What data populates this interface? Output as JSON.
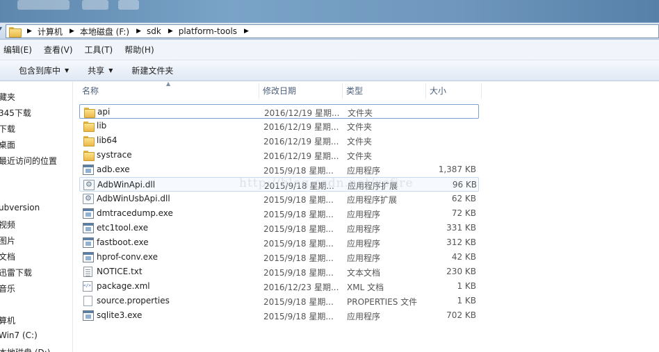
{
  "breadcrumb": [
    "计算机",
    "本地磁盘 (F:)",
    "sdk",
    "platform-tools"
  ],
  "menu": [
    "编辑(E)",
    "查看(V)",
    "工具(T)",
    "帮助(H)"
  ],
  "toolbar": {
    "include_library": "包含到库中",
    "share": "共享",
    "new_folder": "新建文件夹"
  },
  "nav": [
    "藏夹",
    "345下载",
    "下载",
    "桌面",
    "最近访问的位置",
    "ubversion",
    "视频",
    "图片",
    "文档",
    "迅雷下载",
    "音乐",
    "算机",
    "Win7 (C:)",
    "本地磁盘 (D:)"
  ],
  "columns": {
    "name": "名称",
    "date": "修改日期",
    "type": "类型",
    "size": "大小"
  },
  "files": [
    {
      "name": "api",
      "date": "2016/12/19 星期...",
      "type": "文件夹",
      "size": "",
      "icon": "folder"
    },
    {
      "name": "lib",
      "date": "2016/12/19 星期...",
      "type": "文件夹",
      "size": "",
      "icon": "folder"
    },
    {
      "name": "lib64",
      "date": "2016/12/19 星期...",
      "type": "文件夹",
      "size": "",
      "icon": "folder"
    },
    {
      "name": "systrace",
      "date": "2016/12/19 星期...",
      "type": "文件夹",
      "size": "",
      "icon": "folder"
    },
    {
      "name": "adb.exe",
      "date": "2015/9/18 星期...",
      "type": "应用程序",
      "size": "1,387 KB",
      "icon": "exe"
    },
    {
      "name": "AdbWinApi.dll",
      "date": "2015/9/18 星期...",
      "type": "应用程序扩展",
      "size": "96 KB",
      "icon": "dll"
    },
    {
      "name": "AdbWinUsbApi.dll",
      "date": "2015/9/18 星期...",
      "type": "应用程序扩展",
      "size": "62 KB",
      "icon": "dll"
    },
    {
      "name": "dmtracedump.exe",
      "date": "2015/9/18 星期...",
      "type": "应用程序",
      "size": "72 KB",
      "icon": "exe"
    },
    {
      "name": "etc1tool.exe",
      "date": "2015/9/18 星期...",
      "type": "应用程序",
      "size": "331 KB",
      "icon": "exe"
    },
    {
      "name": "fastboot.exe",
      "date": "2015/9/18 星期...",
      "type": "应用程序",
      "size": "312 KB",
      "icon": "exe"
    },
    {
      "name": "hprof-conv.exe",
      "date": "2015/9/18 星期...",
      "type": "应用程序",
      "size": "42 KB",
      "icon": "exe"
    },
    {
      "name": "NOTICE.txt",
      "date": "2015/9/18 星期...",
      "type": "文本文档",
      "size": "230 KB",
      "icon": "txt"
    },
    {
      "name": "package.xml",
      "date": "2016/12/23 星期...",
      "type": "XML 文档",
      "size": "1 KB",
      "icon": "xml"
    },
    {
      "name": "source.properties",
      "date": "2015/9/18 星期...",
      "type": "PROPERTIES 文件",
      "size": "1 KB",
      "icon": "file"
    },
    {
      "name": "sqlite3.exe",
      "date": "2015/9/18 星期...",
      "type": "应用程序",
      "size": "702 KB",
      "icon": "exe"
    }
  ],
  "selected_index": 0,
  "hover_index": 5,
  "watermark": "http://blog.csdn.net/xcfire"
}
